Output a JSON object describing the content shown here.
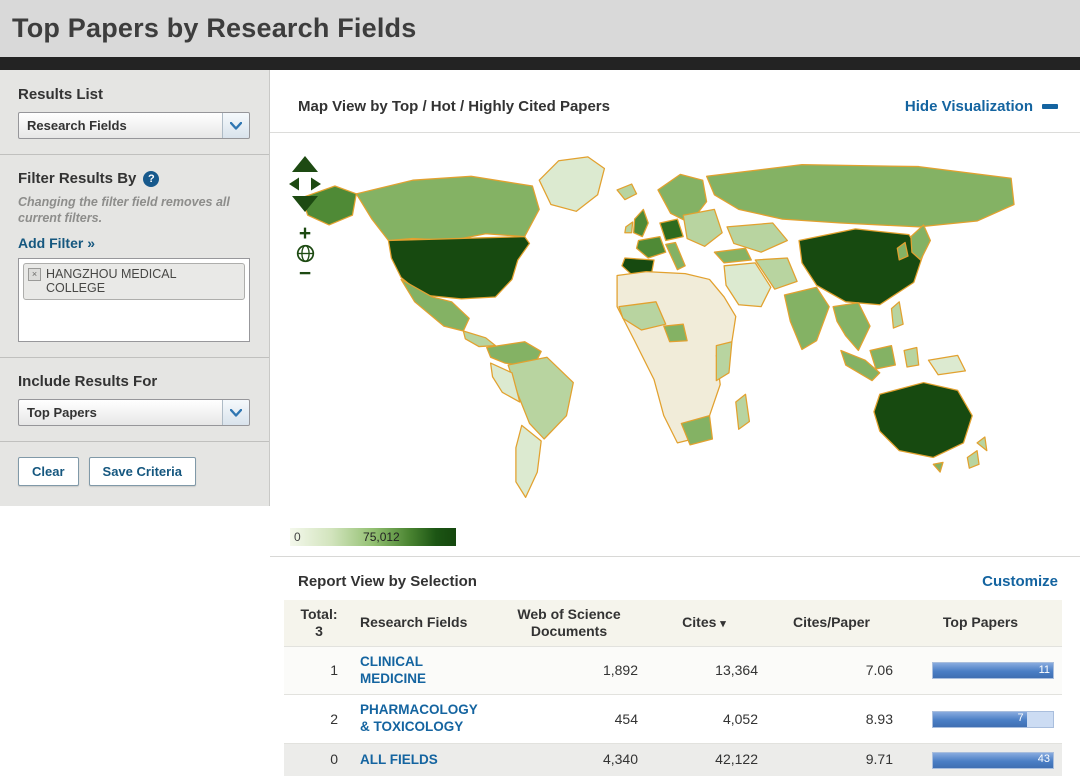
{
  "colors": {
    "accent_blue": "#1464a0",
    "map_border_orange": "#e2a12f",
    "map_green_darkest": "#174a10",
    "bar_blue": "#4a7ec5",
    "control_green": "#1d4a12"
  },
  "header": {
    "title": "Top Papers by Research Fields"
  },
  "sidebar": {
    "results_list": {
      "label": "Results List",
      "value": "Research Fields"
    },
    "filter": {
      "label": "Filter Results By",
      "help_icon": "?",
      "note": "Changing the filter field removes all current filters.",
      "add_filter": "Add Filter »",
      "chips": [
        {
          "remove_icon": "×",
          "label": "HANGZHOU MEDICAL COLLEGE"
        }
      ]
    },
    "include_results": {
      "label": "Include Results For",
      "value": "Top Papers"
    },
    "buttons": {
      "clear": "Clear",
      "save": "Save Criteria"
    }
  },
  "map": {
    "title": "Map View by Top / Hot / Highly Cited Papers",
    "hide_visualization": "Hide Visualization",
    "legend": {
      "min": "0",
      "max": "75,012"
    },
    "controls": {
      "zoom_in": "+",
      "zoom_out": "−"
    }
  },
  "report": {
    "title": "Report View by Selection",
    "customize": "Customize",
    "table": {
      "total_label": "Total:",
      "total_value": "3",
      "columns": [
        "Research Fields",
        "Web of Science Documents",
        "Cites",
        "Cites/Paper",
        "Top Papers"
      ],
      "sort_indicator": "▾",
      "rows": [
        {
          "rank": "1",
          "field": "CLINICAL MEDICINE",
          "documents": "1,892",
          "cites": "13,364",
          "cites_per_paper": "7.06",
          "top_papers": "11",
          "bar_pct": 100
        },
        {
          "rank": "2",
          "field": "PHARMACOLOGY & TOXICOLOGY",
          "documents": "454",
          "cites": "4,052",
          "cites_per_paper": "8.93",
          "top_papers": "7",
          "bar_pct": 78
        },
        {
          "rank": "0",
          "field": "ALL FIELDS",
          "documents": "4,340",
          "cites": "42,122",
          "cites_per_paper": "9.71",
          "top_papers": "43",
          "bar_pct": 100
        }
      ]
    }
  }
}
